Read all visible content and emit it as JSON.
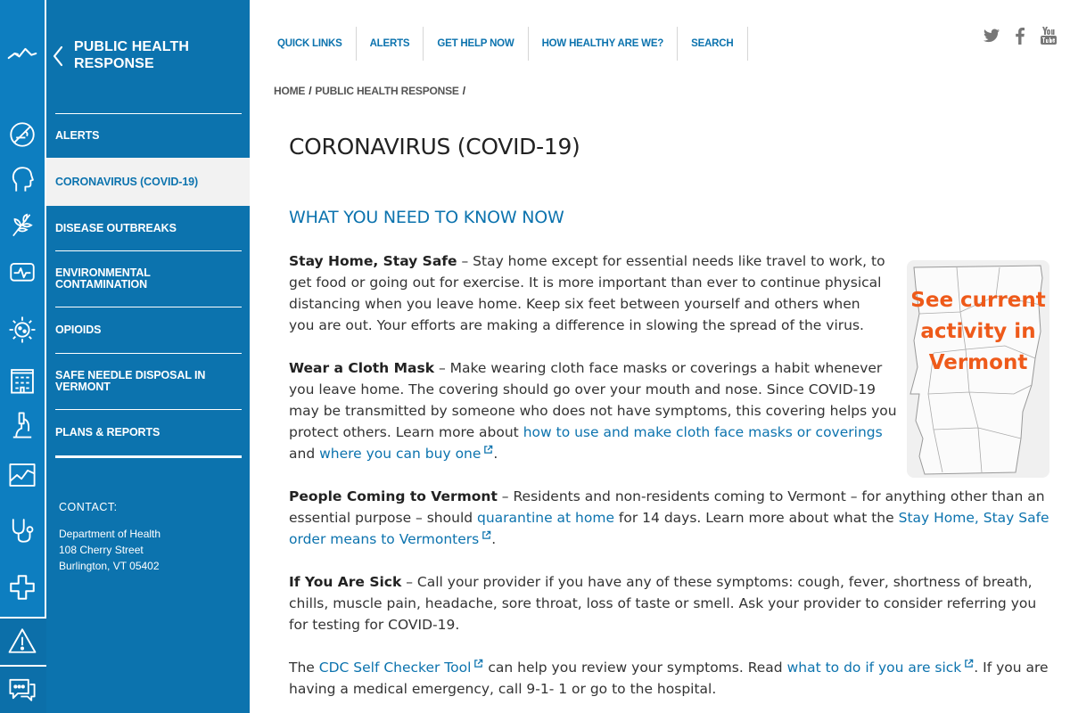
{
  "sidebar": {
    "title": "PUBLIC HEALTH RESPONSE",
    "items": [
      {
        "label": "ALERTS"
      },
      {
        "label": "CORONAVIRUS (COVID-19)"
      },
      {
        "label": "DISEASE OUTBREAKS"
      },
      {
        "label": "ENVIRONMENTAL CONTAMINATION"
      },
      {
        "label": "OPIOIDS"
      },
      {
        "label": "SAFE NEEDLE DISPOSAL IN VERMONT"
      },
      {
        "label": "PLANS & REPORTS"
      }
    ],
    "contact": {
      "label": "CONTACT:",
      "lines": [
        "Department of Health",
        "108 Cherry Street",
        "Burlington, VT 05402"
      ]
    }
  },
  "rail": {
    "icons": [
      "logo-mountain-icon",
      "no-smoking-icon",
      "head-profile-icon",
      "wheat-icon",
      "heart-monitor-icon",
      "virus-sun-icon",
      "building-icon",
      "microscope-icon",
      "chart-icon",
      "stethoscope-icon",
      "plus-icon",
      "warning-icon",
      "chat-icon"
    ]
  },
  "topnav": [
    "QUICK LINKS",
    "ALERTS",
    "GET HELP NOW",
    "HOW HEALTHY ARE WE?",
    "SEARCH"
  ],
  "social": [
    "twitter-icon",
    "facebook-icon",
    "youtube-icon"
  ],
  "breadcrumb": [
    "HOME",
    "PUBLIC HEALTH RESPONSE"
  ],
  "main": {
    "title": "CORONAVIRUS (COVID-19)",
    "subtitle": "WHAT YOU NEED TO KNOW NOW",
    "map_card": {
      "text": "See current activity in Vermont"
    },
    "p1": {
      "bold": "Stay Home, Stay Safe",
      "text": " – Stay home except for essential needs like travel to work, to get food or going out for exercise. It is more important than ever to continue physical distancing when you leave home. Keep six feet between yourself and others when you are out. Your efforts are making a difference in slowing the spread of the virus."
    },
    "p2": {
      "bold": "Wear a Cloth Mask",
      "text": " – Make wearing cloth face masks or coverings a habit whenever you leave home. The covering should go over your mouth and nose. Since COVID-19 may be transmitted by someone who does not have symptoms, this covering helps you protect others. Learn more about ",
      "link1": "how to use and make cloth face masks or coverings",
      "mid": " and ",
      "link2": "where you can buy one",
      "end": "."
    },
    "p3": {
      "bold": "People Coming to Vermont",
      "text": " – Residents and non-residents coming to Vermont – for anything other than an essential purpose – should ",
      "link1": "quarantine at home",
      "mid": " for 14 days. Learn more about what the ",
      "link2": "Stay Home, Stay Safe order means to Vermonters",
      "end": "."
    },
    "p4": {
      "bold": "If You Are Sick",
      "text": " – Call your provider if you have any of these symptoms: cough, fever, shortness of breath, chills, muscle pain, headache, sore throat, loss of taste or smell. Ask your provider to consider referring you for testing for COVID-19."
    },
    "p5": {
      "start": "The ",
      "link1": "CDC Self Checker Tool",
      "mid": " can help you review your symptoms. Read ",
      "link2": "what to do if you are sick",
      "end": ". If you are having a medical emergency, call 9-1- 1 or go to the hospital."
    }
  },
  "colors": {
    "brand_blue": "#0c73ae",
    "rail_blue": "#0d7ec0",
    "map_orange": "#ee5a1a"
  }
}
